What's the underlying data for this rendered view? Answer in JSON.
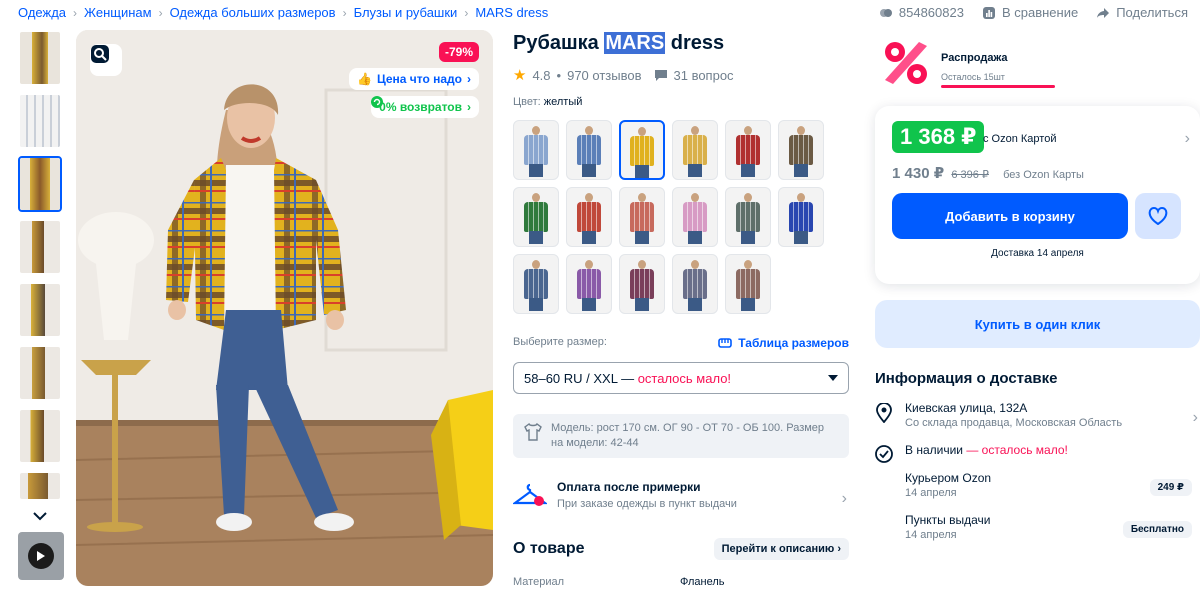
{
  "breadcrumbs": [
    "Одежда",
    "Женщинам",
    "Одежда больших размеров",
    "Блузы и рубашки",
    "MARS dress"
  ],
  "top_actions": {
    "sku": "854860823",
    "compare": "В сравнение",
    "share": "Поделиться"
  },
  "product": {
    "title_prefix": "Рубашка ",
    "title_brand": "MARS",
    "title_suffix": " dress",
    "rating": "4.8",
    "reviews": "970 отзывов",
    "questions": "31 вопрос",
    "color_label": "Цвет:",
    "color_value": "желтый"
  },
  "photo": {
    "discount": "-79%",
    "price_badge": "Цена что надо",
    "returns_badge": "0% возвратов"
  },
  "swatch_colors": [
    "#8aa6cf",
    "#5b7fb8",
    "#e0b11e",
    "#d9b04a",
    "#b03030",
    "#6b5a44",
    "#2f7a3c",
    "#c0483a",
    "#c76a5d",
    "#d79bc4",
    "#5e6f6a",
    "#2946b0",
    "#4a6690",
    "#8a5aa8",
    "#7a3f5a",
    "#6a6f8a",
    "#8c6a62"
  ],
  "swatch_active_index": 2,
  "size": {
    "label": "Выберите размер:",
    "table_link": "Таблица размеров",
    "selected": "58–60 RU / XXL — ",
    "selected_warn": "осталось мало!"
  },
  "model_info": "Модель: рост 170 см. ОГ 90 - ОТ 70 - ОБ 100. Размер на модели: 42-44",
  "pay_after": {
    "title": "Оплата после примерки",
    "subtitle": "При заказе одежды в пункт выдачи"
  },
  "about": {
    "title": "О товаре",
    "link": "Перейти к описанию",
    "attr_key": "Материал",
    "attr_value": "Фланель"
  },
  "sale": {
    "title": "Распродажа",
    "left": "Осталось 15шт"
  },
  "pricing": {
    "ozon_price": "1 368 ₽",
    "ozon_label": "с Ozon Картой",
    "regular_price": "1 430 ₽",
    "old_price": "6 396 ₽",
    "regular_label": "без Ozon Карты",
    "cart_button": "Добавить в корзину",
    "delivery_line": "Доставка 14 апреля",
    "one_click": "Купить в один клик"
  },
  "delivery": {
    "title": "Информация о доставке",
    "address": "Киевская улица, 132А",
    "address_sub": "Со склада продавца, Московская Область",
    "stock": "В наличии",
    "stock_warn": " — осталось мало!",
    "courier": "Курьером Ozon",
    "courier_date": "14 апреля",
    "courier_price": "249 ₽",
    "pickup": "Пункты выдачи",
    "pickup_date": "14 апреля",
    "pickup_price": "Бесплатно"
  },
  "colors": {
    "accent": "#005bff",
    "sale": "#f91155",
    "green": "#10c44c"
  }
}
